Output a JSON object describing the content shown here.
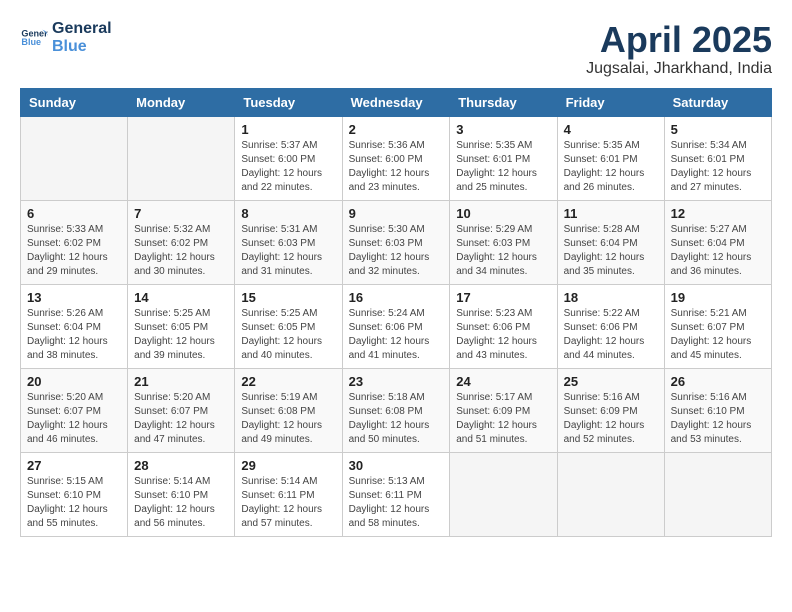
{
  "logo": {
    "line1": "General",
    "line2": "Blue"
  },
  "title": "April 2025",
  "location": "Jugsalai, Jharkhand, India",
  "header": {
    "days": [
      "Sunday",
      "Monday",
      "Tuesday",
      "Wednesday",
      "Thursday",
      "Friday",
      "Saturday"
    ]
  },
  "weeks": [
    [
      {
        "day": "",
        "sunrise": "",
        "sunset": "",
        "daylight": ""
      },
      {
        "day": "",
        "sunrise": "",
        "sunset": "",
        "daylight": ""
      },
      {
        "day": "1",
        "sunrise": "Sunrise: 5:37 AM",
        "sunset": "Sunset: 6:00 PM",
        "daylight": "Daylight: 12 hours and 22 minutes."
      },
      {
        "day": "2",
        "sunrise": "Sunrise: 5:36 AM",
        "sunset": "Sunset: 6:00 PM",
        "daylight": "Daylight: 12 hours and 23 minutes."
      },
      {
        "day": "3",
        "sunrise": "Sunrise: 5:35 AM",
        "sunset": "Sunset: 6:01 PM",
        "daylight": "Daylight: 12 hours and 25 minutes."
      },
      {
        "day": "4",
        "sunrise": "Sunrise: 5:35 AM",
        "sunset": "Sunset: 6:01 PM",
        "daylight": "Daylight: 12 hours and 26 minutes."
      },
      {
        "day": "5",
        "sunrise": "Sunrise: 5:34 AM",
        "sunset": "Sunset: 6:01 PM",
        "daylight": "Daylight: 12 hours and 27 minutes."
      }
    ],
    [
      {
        "day": "6",
        "sunrise": "Sunrise: 5:33 AM",
        "sunset": "Sunset: 6:02 PM",
        "daylight": "Daylight: 12 hours and 29 minutes."
      },
      {
        "day": "7",
        "sunrise": "Sunrise: 5:32 AM",
        "sunset": "Sunset: 6:02 PM",
        "daylight": "Daylight: 12 hours and 30 minutes."
      },
      {
        "day": "8",
        "sunrise": "Sunrise: 5:31 AM",
        "sunset": "Sunset: 6:03 PM",
        "daylight": "Daylight: 12 hours and 31 minutes."
      },
      {
        "day": "9",
        "sunrise": "Sunrise: 5:30 AM",
        "sunset": "Sunset: 6:03 PM",
        "daylight": "Daylight: 12 hours and 32 minutes."
      },
      {
        "day": "10",
        "sunrise": "Sunrise: 5:29 AM",
        "sunset": "Sunset: 6:03 PM",
        "daylight": "Daylight: 12 hours and 34 minutes."
      },
      {
        "day": "11",
        "sunrise": "Sunrise: 5:28 AM",
        "sunset": "Sunset: 6:04 PM",
        "daylight": "Daylight: 12 hours and 35 minutes."
      },
      {
        "day": "12",
        "sunrise": "Sunrise: 5:27 AM",
        "sunset": "Sunset: 6:04 PM",
        "daylight": "Daylight: 12 hours and 36 minutes."
      }
    ],
    [
      {
        "day": "13",
        "sunrise": "Sunrise: 5:26 AM",
        "sunset": "Sunset: 6:04 PM",
        "daylight": "Daylight: 12 hours and 38 minutes."
      },
      {
        "day": "14",
        "sunrise": "Sunrise: 5:25 AM",
        "sunset": "Sunset: 6:05 PM",
        "daylight": "Daylight: 12 hours and 39 minutes."
      },
      {
        "day": "15",
        "sunrise": "Sunrise: 5:25 AM",
        "sunset": "Sunset: 6:05 PM",
        "daylight": "Daylight: 12 hours and 40 minutes."
      },
      {
        "day": "16",
        "sunrise": "Sunrise: 5:24 AM",
        "sunset": "Sunset: 6:06 PM",
        "daylight": "Daylight: 12 hours and 41 minutes."
      },
      {
        "day": "17",
        "sunrise": "Sunrise: 5:23 AM",
        "sunset": "Sunset: 6:06 PM",
        "daylight": "Daylight: 12 hours and 43 minutes."
      },
      {
        "day": "18",
        "sunrise": "Sunrise: 5:22 AM",
        "sunset": "Sunset: 6:06 PM",
        "daylight": "Daylight: 12 hours and 44 minutes."
      },
      {
        "day": "19",
        "sunrise": "Sunrise: 5:21 AM",
        "sunset": "Sunset: 6:07 PM",
        "daylight": "Daylight: 12 hours and 45 minutes."
      }
    ],
    [
      {
        "day": "20",
        "sunrise": "Sunrise: 5:20 AM",
        "sunset": "Sunset: 6:07 PM",
        "daylight": "Daylight: 12 hours and 46 minutes."
      },
      {
        "day": "21",
        "sunrise": "Sunrise: 5:20 AM",
        "sunset": "Sunset: 6:07 PM",
        "daylight": "Daylight: 12 hours and 47 minutes."
      },
      {
        "day": "22",
        "sunrise": "Sunrise: 5:19 AM",
        "sunset": "Sunset: 6:08 PM",
        "daylight": "Daylight: 12 hours and 49 minutes."
      },
      {
        "day": "23",
        "sunrise": "Sunrise: 5:18 AM",
        "sunset": "Sunset: 6:08 PM",
        "daylight": "Daylight: 12 hours and 50 minutes."
      },
      {
        "day": "24",
        "sunrise": "Sunrise: 5:17 AM",
        "sunset": "Sunset: 6:09 PM",
        "daylight": "Daylight: 12 hours and 51 minutes."
      },
      {
        "day": "25",
        "sunrise": "Sunrise: 5:16 AM",
        "sunset": "Sunset: 6:09 PM",
        "daylight": "Daylight: 12 hours and 52 minutes."
      },
      {
        "day": "26",
        "sunrise": "Sunrise: 5:16 AM",
        "sunset": "Sunset: 6:10 PM",
        "daylight": "Daylight: 12 hours and 53 minutes."
      }
    ],
    [
      {
        "day": "27",
        "sunrise": "Sunrise: 5:15 AM",
        "sunset": "Sunset: 6:10 PM",
        "daylight": "Daylight: 12 hours and 55 minutes."
      },
      {
        "day": "28",
        "sunrise": "Sunrise: 5:14 AM",
        "sunset": "Sunset: 6:10 PM",
        "daylight": "Daylight: 12 hours and 56 minutes."
      },
      {
        "day": "29",
        "sunrise": "Sunrise: 5:14 AM",
        "sunset": "Sunset: 6:11 PM",
        "daylight": "Daylight: 12 hours and 57 minutes."
      },
      {
        "day": "30",
        "sunrise": "Sunrise: 5:13 AM",
        "sunset": "Sunset: 6:11 PM",
        "daylight": "Daylight: 12 hours and 58 minutes."
      },
      {
        "day": "",
        "sunrise": "",
        "sunset": "",
        "daylight": ""
      },
      {
        "day": "",
        "sunrise": "",
        "sunset": "",
        "daylight": ""
      },
      {
        "day": "",
        "sunrise": "",
        "sunset": "",
        "daylight": ""
      }
    ]
  ]
}
